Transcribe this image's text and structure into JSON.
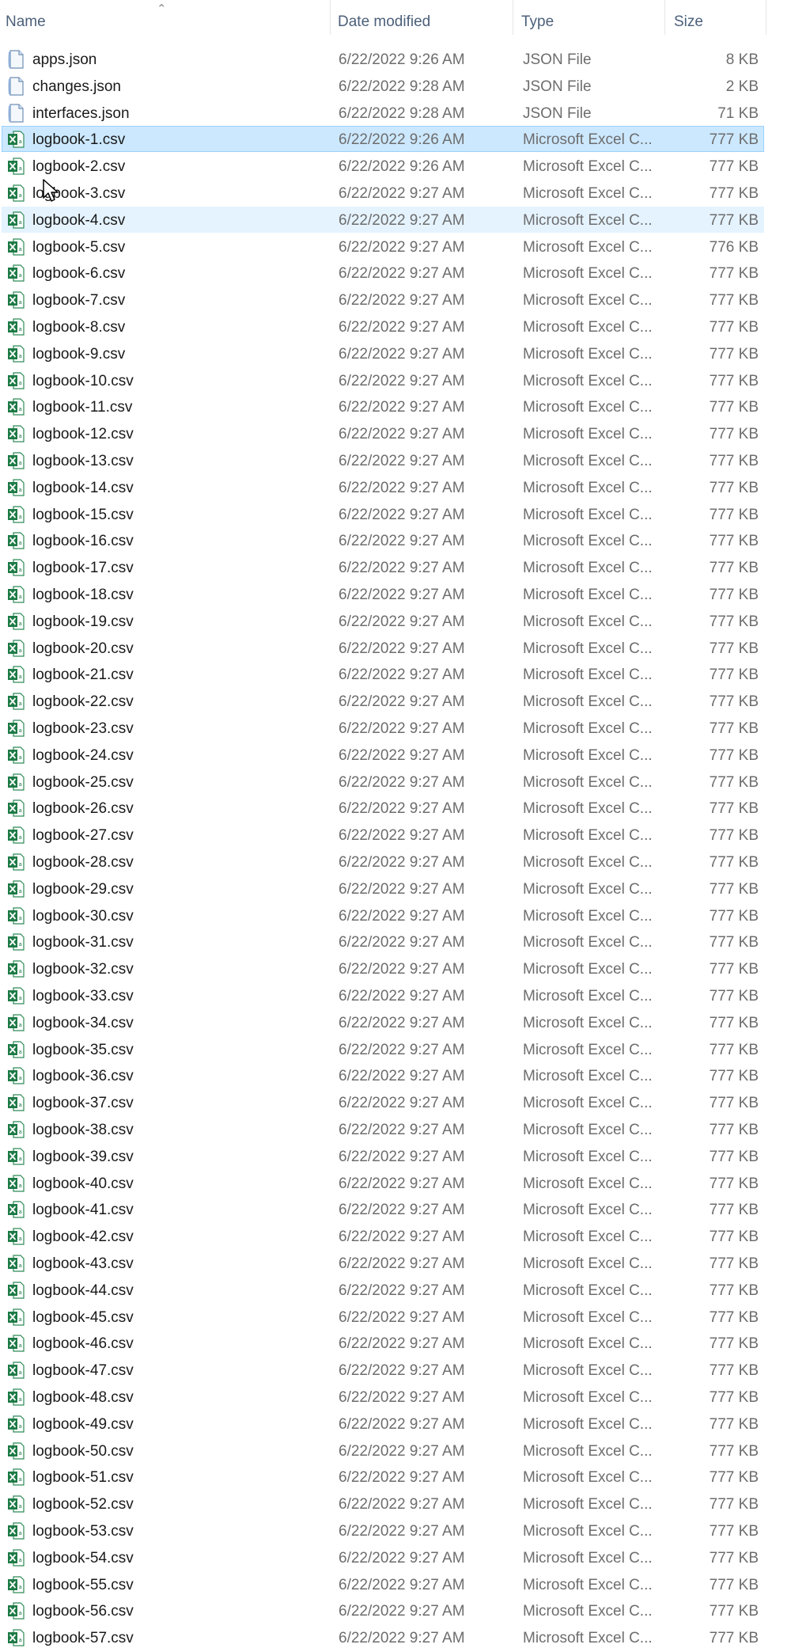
{
  "columns": {
    "name": "Name",
    "date": "Date modified",
    "type": "Type",
    "size": "Size"
  },
  "sort": {
    "column": "name",
    "direction": "ascending",
    "icon": "sort-up-arrow-icon"
  },
  "colors": {
    "selected_bg": "#cce8ff",
    "selected_border": "#99d1ff",
    "hover_bg": "#e5f3ff",
    "excel_green": "#1d7a45"
  },
  "files": [
    {
      "name": "apps.json",
      "date": "6/22/2022 9:26 AM",
      "type": "JSON File",
      "size": "8 KB",
      "icon": "json-file-icon"
    },
    {
      "name": "changes.json",
      "date": "6/22/2022 9:28 AM",
      "type": "JSON File",
      "size": "2 KB",
      "icon": "json-file-icon"
    },
    {
      "name": "interfaces.json",
      "date": "6/22/2022 9:28 AM",
      "type": "JSON File",
      "size": "71 KB",
      "icon": "json-file-icon"
    },
    {
      "name": "logbook-1.csv",
      "date": "6/22/2022 9:26 AM",
      "type": "Microsoft Excel C...",
      "size": "777 KB",
      "icon": "excel-file-icon",
      "state": "selected"
    },
    {
      "name": "logbook-2.csv",
      "date": "6/22/2022 9:26 AM",
      "type": "Microsoft Excel C...",
      "size": "777 KB",
      "icon": "excel-file-icon"
    },
    {
      "name": "logbook-3.csv",
      "date": "6/22/2022 9:27 AM",
      "type": "Microsoft Excel C...",
      "size": "777 KB",
      "icon": "excel-file-icon"
    },
    {
      "name": "logbook-4.csv",
      "date": "6/22/2022 9:27 AM",
      "type": "Microsoft Excel C...",
      "size": "777 KB",
      "icon": "excel-file-icon",
      "state": "hover"
    },
    {
      "name": "logbook-5.csv",
      "date": "6/22/2022 9:27 AM",
      "type": "Microsoft Excel C...",
      "size": "776 KB",
      "icon": "excel-file-icon"
    },
    {
      "name": "logbook-6.csv",
      "date": "6/22/2022 9:27 AM",
      "type": "Microsoft Excel C...",
      "size": "777 KB",
      "icon": "excel-file-icon"
    },
    {
      "name": "logbook-7.csv",
      "date": "6/22/2022 9:27 AM",
      "type": "Microsoft Excel C...",
      "size": "777 KB",
      "icon": "excel-file-icon"
    },
    {
      "name": "logbook-8.csv",
      "date": "6/22/2022 9:27 AM",
      "type": "Microsoft Excel C...",
      "size": "777 KB",
      "icon": "excel-file-icon"
    },
    {
      "name": "logbook-9.csv",
      "date": "6/22/2022 9:27 AM",
      "type": "Microsoft Excel C...",
      "size": "777 KB",
      "icon": "excel-file-icon"
    },
    {
      "name": "logbook-10.csv",
      "date": "6/22/2022 9:27 AM",
      "type": "Microsoft Excel C...",
      "size": "777 KB",
      "icon": "excel-file-icon"
    },
    {
      "name": "logbook-11.csv",
      "date": "6/22/2022 9:27 AM",
      "type": "Microsoft Excel C...",
      "size": "777 KB",
      "icon": "excel-file-icon"
    },
    {
      "name": "logbook-12.csv",
      "date": "6/22/2022 9:27 AM",
      "type": "Microsoft Excel C...",
      "size": "777 KB",
      "icon": "excel-file-icon"
    },
    {
      "name": "logbook-13.csv",
      "date": "6/22/2022 9:27 AM",
      "type": "Microsoft Excel C...",
      "size": "777 KB",
      "icon": "excel-file-icon"
    },
    {
      "name": "logbook-14.csv",
      "date": "6/22/2022 9:27 AM",
      "type": "Microsoft Excel C...",
      "size": "777 KB",
      "icon": "excel-file-icon"
    },
    {
      "name": "logbook-15.csv",
      "date": "6/22/2022 9:27 AM",
      "type": "Microsoft Excel C...",
      "size": "777 KB",
      "icon": "excel-file-icon"
    },
    {
      "name": "logbook-16.csv",
      "date": "6/22/2022 9:27 AM",
      "type": "Microsoft Excel C...",
      "size": "777 KB",
      "icon": "excel-file-icon"
    },
    {
      "name": "logbook-17.csv",
      "date": "6/22/2022 9:27 AM",
      "type": "Microsoft Excel C...",
      "size": "777 KB",
      "icon": "excel-file-icon"
    },
    {
      "name": "logbook-18.csv",
      "date": "6/22/2022 9:27 AM",
      "type": "Microsoft Excel C...",
      "size": "777 KB",
      "icon": "excel-file-icon"
    },
    {
      "name": "logbook-19.csv",
      "date": "6/22/2022 9:27 AM",
      "type": "Microsoft Excel C...",
      "size": "777 KB",
      "icon": "excel-file-icon"
    },
    {
      "name": "logbook-20.csv",
      "date": "6/22/2022 9:27 AM",
      "type": "Microsoft Excel C...",
      "size": "777 KB",
      "icon": "excel-file-icon"
    },
    {
      "name": "logbook-21.csv",
      "date": "6/22/2022 9:27 AM",
      "type": "Microsoft Excel C...",
      "size": "777 KB",
      "icon": "excel-file-icon"
    },
    {
      "name": "logbook-22.csv",
      "date": "6/22/2022 9:27 AM",
      "type": "Microsoft Excel C...",
      "size": "777 KB",
      "icon": "excel-file-icon"
    },
    {
      "name": "logbook-23.csv",
      "date": "6/22/2022 9:27 AM",
      "type": "Microsoft Excel C...",
      "size": "777 KB",
      "icon": "excel-file-icon"
    },
    {
      "name": "logbook-24.csv",
      "date": "6/22/2022 9:27 AM",
      "type": "Microsoft Excel C...",
      "size": "777 KB",
      "icon": "excel-file-icon"
    },
    {
      "name": "logbook-25.csv",
      "date": "6/22/2022 9:27 AM",
      "type": "Microsoft Excel C...",
      "size": "777 KB",
      "icon": "excel-file-icon"
    },
    {
      "name": "logbook-26.csv",
      "date": "6/22/2022 9:27 AM",
      "type": "Microsoft Excel C...",
      "size": "777 KB",
      "icon": "excel-file-icon"
    },
    {
      "name": "logbook-27.csv",
      "date": "6/22/2022 9:27 AM",
      "type": "Microsoft Excel C...",
      "size": "777 KB",
      "icon": "excel-file-icon"
    },
    {
      "name": "logbook-28.csv",
      "date": "6/22/2022 9:27 AM",
      "type": "Microsoft Excel C...",
      "size": "777 KB",
      "icon": "excel-file-icon"
    },
    {
      "name": "logbook-29.csv",
      "date": "6/22/2022 9:27 AM",
      "type": "Microsoft Excel C...",
      "size": "777 KB",
      "icon": "excel-file-icon"
    },
    {
      "name": "logbook-30.csv",
      "date": "6/22/2022 9:27 AM",
      "type": "Microsoft Excel C...",
      "size": "777 KB",
      "icon": "excel-file-icon"
    },
    {
      "name": "logbook-31.csv",
      "date": "6/22/2022 9:27 AM",
      "type": "Microsoft Excel C...",
      "size": "777 KB",
      "icon": "excel-file-icon"
    },
    {
      "name": "logbook-32.csv",
      "date": "6/22/2022 9:27 AM",
      "type": "Microsoft Excel C...",
      "size": "777 KB",
      "icon": "excel-file-icon"
    },
    {
      "name": "logbook-33.csv",
      "date": "6/22/2022 9:27 AM",
      "type": "Microsoft Excel C...",
      "size": "777 KB",
      "icon": "excel-file-icon"
    },
    {
      "name": "logbook-34.csv",
      "date": "6/22/2022 9:27 AM",
      "type": "Microsoft Excel C...",
      "size": "777 KB",
      "icon": "excel-file-icon"
    },
    {
      "name": "logbook-35.csv",
      "date": "6/22/2022 9:27 AM",
      "type": "Microsoft Excel C...",
      "size": "777 KB",
      "icon": "excel-file-icon"
    },
    {
      "name": "logbook-36.csv",
      "date": "6/22/2022 9:27 AM",
      "type": "Microsoft Excel C...",
      "size": "777 KB",
      "icon": "excel-file-icon"
    },
    {
      "name": "logbook-37.csv",
      "date": "6/22/2022 9:27 AM",
      "type": "Microsoft Excel C...",
      "size": "777 KB",
      "icon": "excel-file-icon"
    },
    {
      "name": "logbook-38.csv",
      "date": "6/22/2022 9:27 AM",
      "type": "Microsoft Excel C...",
      "size": "777 KB",
      "icon": "excel-file-icon"
    },
    {
      "name": "logbook-39.csv",
      "date": "6/22/2022 9:27 AM",
      "type": "Microsoft Excel C...",
      "size": "777 KB",
      "icon": "excel-file-icon"
    },
    {
      "name": "logbook-40.csv",
      "date": "6/22/2022 9:27 AM",
      "type": "Microsoft Excel C...",
      "size": "777 KB",
      "icon": "excel-file-icon"
    },
    {
      "name": "logbook-41.csv",
      "date": "6/22/2022 9:27 AM",
      "type": "Microsoft Excel C...",
      "size": "777 KB",
      "icon": "excel-file-icon"
    },
    {
      "name": "logbook-42.csv",
      "date": "6/22/2022 9:27 AM",
      "type": "Microsoft Excel C...",
      "size": "777 KB",
      "icon": "excel-file-icon"
    },
    {
      "name": "logbook-43.csv",
      "date": "6/22/2022 9:27 AM",
      "type": "Microsoft Excel C...",
      "size": "777 KB",
      "icon": "excel-file-icon"
    },
    {
      "name": "logbook-44.csv",
      "date": "6/22/2022 9:27 AM",
      "type": "Microsoft Excel C...",
      "size": "777 KB",
      "icon": "excel-file-icon"
    },
    {
      "name": "logbook-45.csv",
      "date": "6/22/2022 9:27 AM",
      "type": "Microsoft Excel C...",
      "size": "777 KB",
      "icon": "excel-file-icon"
    },
    {
      "name": "logbook-46.csv",
      "date": "6/22/2022 9:27 AM",
      "type": "Microsoft Excel C...",
      "size": "777 KB",
      "icon": "excel-file-icon"
    },
    {
      "name": "logbook-47.csv",
      "date": "6/22/2022 9:27 AM",
      "type": "Microsoft Excel C...",
      "size": "777 KB",
      "icon": "excel-file-icon"
    },
    {
      "name": "logbook-48.csv",
      "date": "6/22/2022 9:27 AM",
      "type": "Microsoft Excel C...",
      "size": "777 KB",
      "icon": "excel-file-icon"
    },
    {
      "name": "logbook-49.csv",
      "date": "6/22/2022 9:27 AM",
      "type": "Microsoft Excel C...",
      "size": "777 KB",
      "icon": "excel-file-icon"
    },
    {
      "name": "logbook-50.csv",
      "date": "6/22/2022 9:27 AM",
      "type": "Microsoft Excel C...",
      "size": "777 KB",
      "icon": "excel-file-icon"
    },
    {
      "name": "logbook-51.csv",
      "date": "6/22/2022 9:27 AM",
      "type": "Microsoft Excel C...",
      "size": "777 KB",
      "icon": "excel-file-icon"
    },
    {
      "name": "logbook-52.csv",
      "date": "6/22/2022 9:27 AM",
      "type": "Microsoft Excel C...",
      "size": "777 KB",
      "icon": "excel-file-icon"
    },
    {
      "name": "logbook-53.csv",
      "date": "6/22/2022 9:27 AM",
      "type": "Microsoft Excel C...",
      "size": "777 KB",
      "icon": "excel-file-icon"
    },
    {
      "name": "logbook-54.csv",
      "date": "6/22/2022 9:27 AM",
      "type": "Microsoft Excel C...",
      "size": "777 KB",
      "icon": "excel-file-icon"
    },
    {
      "name": "logbook-55.csv",
      "date": "6/22/2022 9:27 AM",
      "type": "Microsoft Excel C...",
      "size": "777 KB",
      "icon": "excel-file-icon"
    },
    {
      "name": "logbook-56.csv",
      "date": "6/22/2022 9:27 AM",
      "type": "Microsoft Excel C...",
      "size": "777 KB",
      "icon": "excel-file-icon"
    },
    {
      "name": "logbook-57.csv",
      "date": "6/22/2022 9:27 AM",
      "type": "Microsoft Excel C...",
      "size": "777 KB",
      "icon": "excel-file-icon"
    }
  ],
  "cursor": {
    "icon": "mouse-pointer-icon"
  }
}
